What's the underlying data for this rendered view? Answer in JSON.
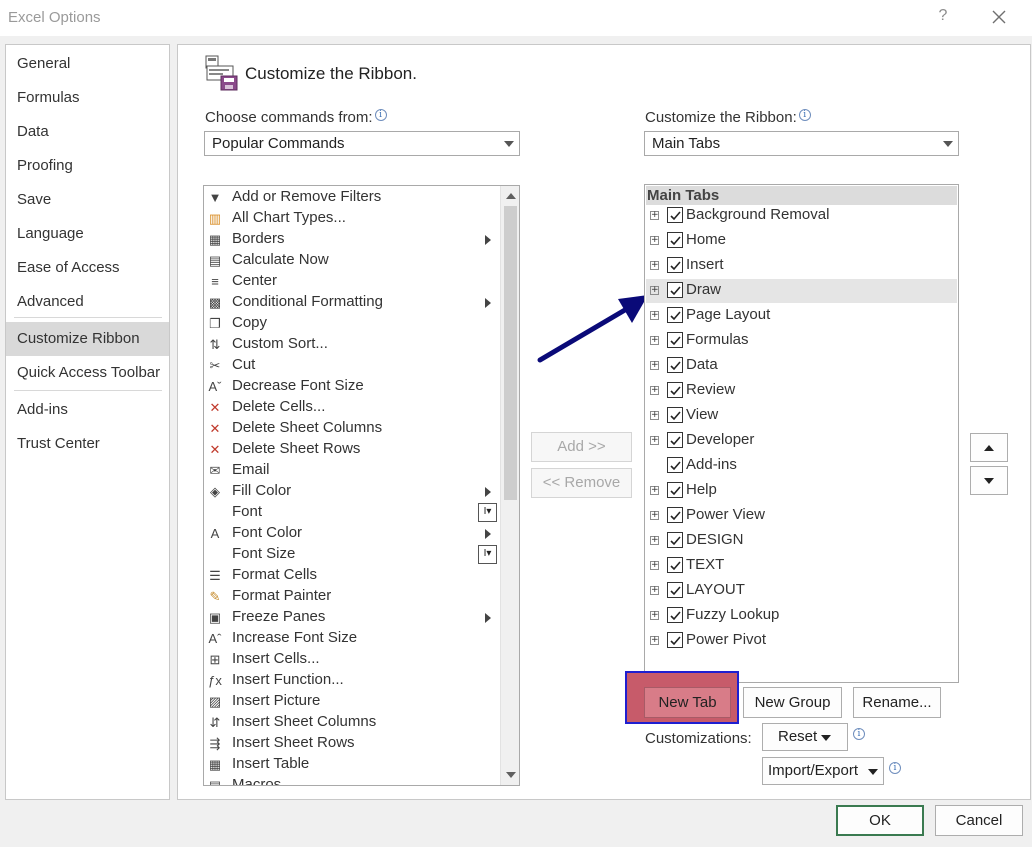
{
  "window": {
    "title": "Excel Options",
    "help_glyph": "?",
    "close_icon": "close-icon"
  },
  "nav": {
    "items": [
      {
        "label": "General"
      },
      {
        "label": "Formulas"
      },
      {
        "label": "Data"
      },
      {
        "label": "Proofing"
      },
      {
        "label": "Save"
      },
      {
        "label": "Language"
      },
      {
        "label": "Ease of Access"
      },
      {
        "label": "Advanced"
      },
      {
        "label": "Customize Ribbon",
        "selected": true
      },
      {
        "label": "Quick Access Toolbar"
      },
      {
        "label": "Add-ins"
      },
      {
        "label": "Trust Center"
      }
    ]
  },
  "page": {
    "heading": "Customize the Ribbon.",
    "heading_icon": "customize-ribbon-icon"
  },
  "commands": {
    "label": "Choose commands from:",
    "dropdown_value": "Popular Commands",
    "items": [
      {
        "label": "Add or Remove Filters",
        "icon": "filter-icon"
      },
      {
        "label": "All Chart Types...",
        "icon": "chart-icon"
      },
      {
        "label": "Borders",
        "icon": "borders-icon",
        "submenu": true
      },
      {
        "label": "Calculate Now",
        "icon": "calculator-icon"
      },
      {
        "label": "Center",
        "icon": "align-center-icon"
      },
      {
        "label": "Conditional Formatting",
        "icon": "conditional-formatting-icon",
        "submenu": true
      },
      {
        "label": "Copy",
        "icon": "copy-icon"
      },
      {
        "label": "Custom Sort...",
        "icon": "sort-icon"
      },
      {
        "label": "Cut",
        "icon": "scissors-icon"
      },
      {
        "label": "Decrease Font Size",
        "icon": "decrease-font-icon"
      },
      {
        "label": "Delete Cells...",
        "icon": "delete-cells-icon"
      },
      {
        "label": "Delete Sheet Columns",
        "icon": "delete-columns-icon"
      },
      {
        "label": "Delete Sheet Rows",
        "icon": "delete-rows-icon"
      },
      {
        "label": "Email",
        "icon": "email-icon"
      },
      {
        "label": "Fill Color",
        "icon": "fill-color-icon",
        "submenu": true
      },
      {
        "label": "Font",
        "icon": "font-icon",
        "spinner": true
      },
      {
        "label": "Font Color",
        "icon": "font-color-icon",
        "submenu": true
      },
      {
        "label": "Font Size",
        "icon": "font-size-icon",
        "spinner": true
      },
      {
        "label": "Format Cells",
        "icon": "format-cells-icon"
      },
      {
        "label": "Format Painter",
        "icon": "format-painter-icon"
      },
      {
        "label": "Freeze Panes",
        "icon": "freeze-panes-icon",
        "submenu": true
      },
      {
        "label": "Increase Font Size",
        "icon": "increase-font-icon"
      },
      {
        "label": "Insert Cells...",
        "icon": "insert-cells-icon"
      },
      {
        "label": "Insert Function...",
        "icon": "function-icon"
      },
      {
        "label": "Insert Picture",
        "icon": "picture-icon"
      },
      {
        "label": "Insert Sheet Columns",
        "icon": "insert-columns-icon"
      },
      {
        "label": "Insert Sheet Rows",
        "icon": "insert-rows-icon"
      },
      {
        "label": "Insert Table",
        "icon": "table-icon"
      },
      {
        "label": "Macros",
        "icon": "macros-icon"
      }
    ]
  },
  "transfer": {
    "add_label": "Add >>",
    "remove_label": "<< Remove"
  },
  "ribbon": {
    "label": "Customize the Ribbon:",
    "dropdown_value": "Main Tabs",
    "tree_header": "Main Tabs",
    "tabs": [
      {
        "label": "Background Removal",
        "checked": true,
        "expandable": true
      },
      {
        "label": "Home",
        "checked": true,
        "expandable": true
      },
      {
        "label": "Insert",
        "checked": true,
        "expandable": true
      },
      {
        "label": "Draw",
        "checked": true,
        "expandable": true,
        "selected": true
      },
      {
        "label": "Page Layout",
        "checked": true,
        "expandable": true
      },
      {
        "label": "Formulas",
        "checked": true,
        "expandable": true
      },
      {
        "label": "Data",
        "checked": true,
        "expandable": true
      },
      {
        "label": "Review",
        "checked": true,
        "expandable": true
      },
      {
        "label": "View",
        "checked": true,
        "expandable": true
      },
      {
        "label": "Developer",
        "checked": true,
        "expandable": true
      },
      {
        "label": "Add-ins",
        "checked": true,
        "expandable": false
      },
      {
        "label": "Help",
        "checked": true,
        "expandable": true
      },
      {
        "label": "Power View",
        "checked": true,
        "expandable": true
      },
      {
        "label": "DESIGN",
        "checked": true,
        "expandable": true
      },
      {
        "label": "TEXT",
        "checked": true,
        "expandable": true
      },
      {
        "label": "LAYOUT",
        "checked": true,
        "expandable": true
      },
      {
        "label": "Fuzzy Lookup",
        "checked": true,
        "expandable": true
      },
      {
        "label": "Power Pivot",
        "checked": true,
        "expandable": true
      }
    ],
    "new_tab_label": "New Tab",
    "new_group_label": "New Group",
    "rename_label": "Rename...",
    "customizations_label": "Customizations:",
    "reset_label": "Reset",
    "import_export_label": "Import/Export"
  },
  "dialog": {
    "ok_label": "OK",
    "cancel_label": "Cancel"
  },
  "annotations": {
    "arrow_color": "#0a0a78",
    "highlight_border": "#1f1fd0",
    "highlight_fill": "#c75b6a"
  },
  "colors": {
    "selected_nav": "#d9d9d9",
    "tree_header_bg": "#dcdcdc"
  }
}
